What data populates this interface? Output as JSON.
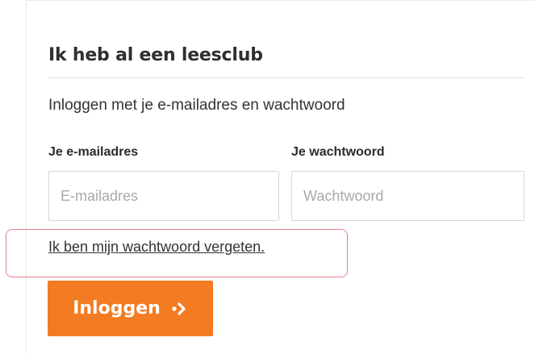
{
  "section": {
    "title": "Ik heb al een leesclub",
    "subtitle": "Inloggen met je e-mailadres en wachtwoord"
  },
  "form": {
    "email_label": "Je e-mailadres",
    "email_placeholder": "E-mailadres",
    "email_value": "",
    "password_label": "Je wachtwoord",
    "password_placeholder": "Wachtwoord",
    "password_value": "",
    "forgot_link": "Ik ben mijn wachtwoord vergeten.",
    "submit_label": "Inloggen"
  },
  "colors": {
    "accent": "#f37b21",
    "highlight_border": "#e8808a"
  },
  "icons": {
    "submit_icon": "arrow-right-dotted-icon"
  }
}
